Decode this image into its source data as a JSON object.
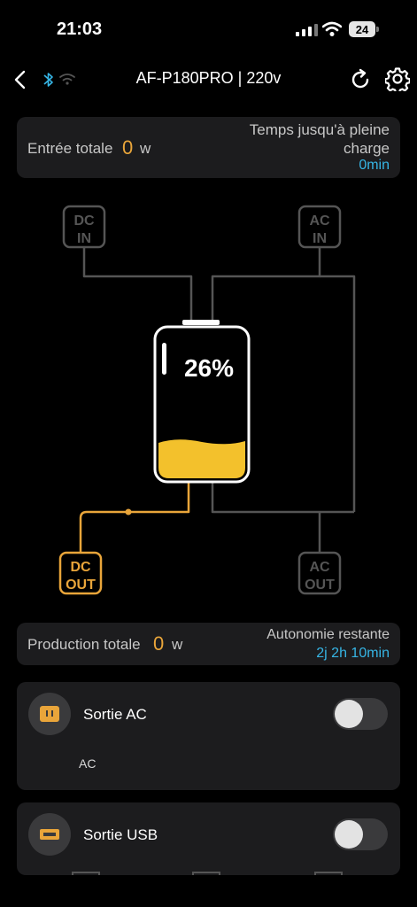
{
  "status": {
    "time": "21:03",
    "battery": "24"
  },
  "header": {
    "title": "AF-P180PRO | 220v"
  },
  "input": {
    "label": "Entrée totale",
    "value": "0",
    "unit": "w",
    "time_label_1": "Temps jusqu'à pleine",
    "time_label_2": "charge",
    "time_value": "0min"
  },
  "diagram": {
    "dc_in_1": "DC",
    "dc_in_2": "IN",
    "ac_in_1": "AC",
    "ac_in_2": "IN",
    "dc_out_1": "DC",
    "dc_out_2": "OUT",
    "ac_out_1": "AC",
    "ac_out_2": "OUT",
    "battery_percent": "26%",
    "battery_level": 0.26
  },
  "output": {
    "label": "Production totale",
    "value": "0",
    "unit": "w",
    "autonomy_label": "Autonomie restante",
    "autonomy_value": "2j 2h 10min"
  },
  "ac_card": {
    "label": "Sortie AC",
    "sub": "AC"
  },
  "usb_card": {
    "label": "Sortie USB"
  },
  "colors": {
    "accent": "#e9a53a",
    "info": "#36b5e5",
    "battery_fill": "#f3c12c"
  }
}
